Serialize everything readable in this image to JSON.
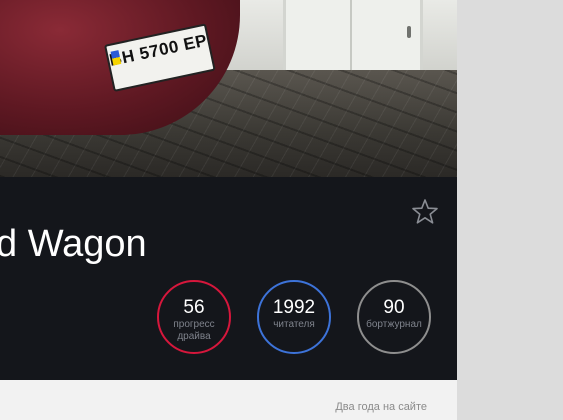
{
  "photo": {
    "license_plate": "BH 5700 EP"
  },
  "car": {
    "title": "d Wagon"
  },
  "favorite": {
    "icon": "star-outline-icon"
  },
  "stats": [
    {
      "value": "56",
      "label_line1": "прогресс",
      "label_line2": "драйва",
      "color": "#d6173c"
    },
    {
      "value": "1992",
      "label_line1": "читателя",
      "label_line2": "",
      "color": "#3d73d9"
    },
    {
      "value": "90",
      "label_line1": "бортжурнал",
      "label_line2": "",
      "color": "#8e8e8e"
    }
  ],
  "footer": {
    "since_text": "Два года на сайте"
  },
  "colors": {
    "dark_bg": "#14161b",
    "page_bg": "#dcdcdc",
    "footer_bg": "#f2f2f2"
  }
}
